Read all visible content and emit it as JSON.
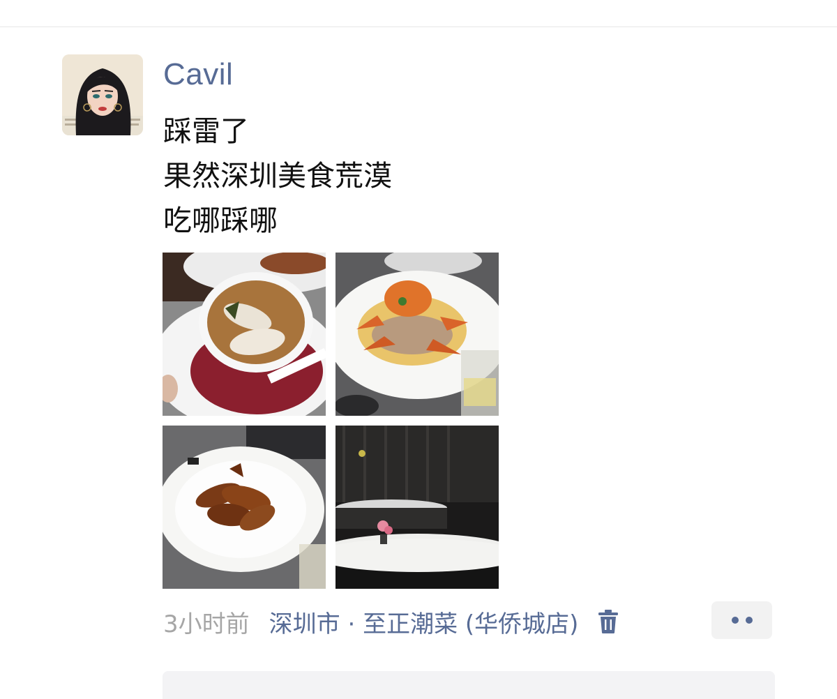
{
  "post": {
    "username": "Cavil",
    "text_lines": [
      "踩雷了",
      "果然深圳美食荒漠",
      "吃哪踩哪"
    ],
    "time": "3小时前",
    "location": "深圳市 · 至正潮菜 (华侨城店)",
    "photos": [
      {
        "icon": "soup-bowl-photo"
      },
      {
        "icon": "crab-dish-photo"
      },
      {
        "icon": "braised-goose-photo"
      },
      {
        "icon": "restaurant-table-photo"
      }
    ]
  },
  "colors": {
    "link": "#576b95",
    "time": "#a6a6a6",
    "text": "#111111",
    "more_button_bg": "#f2f2f2"
  },
  "icons": {
    "delete": "trash-icon",
    "more": "more-dots-icon"
  }
}
